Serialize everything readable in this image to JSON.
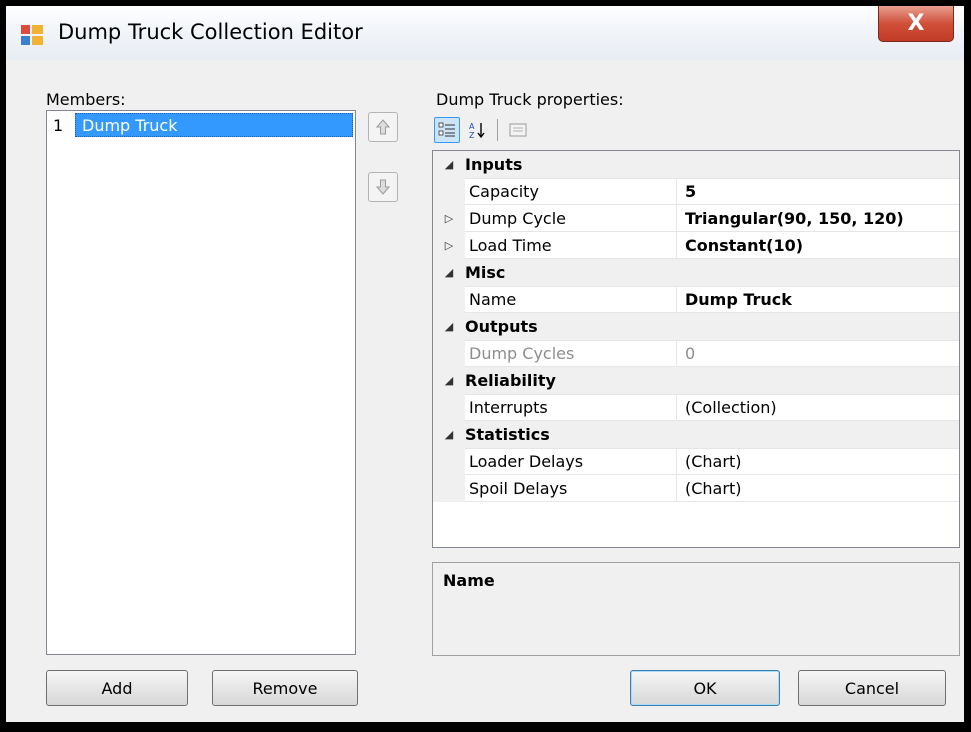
{
  "window": {
    "title": "Dump Truck Collection Editor",
    "close_label": "X"
  },
  "members": {
    "label": "Members:",
    "items": [
      {
        "index": "1",
        "name": "Dump Truck",
        "selected": true
      }
    ]
  },
  "properties": {
    "label": "Dump Truck properties:",
    "toolbar": [
      "categorized-icon",
      "alphabetical-icon",
      "property-pages-icon"
    ],
    "categories": [
      {
        "name": "Inputs",
        "props": [
          {
            "name": "Capacity",
            "value": "5",
            "bold": true,
            "expandable": false
          },
          {
            "name": "Dump Cycle",
            "value": "Triangular(90, 150, 120)",
            "bold": true,
            "expandable": true
          },
          {
            "name": "Load Time",
            "value": "Constant(10)",
            "bold": true,
            "expandable": true
          }
        ]
      },
      {
        "name": "Misc",
        "props": [
          {
            "name": "Name",
            "value": "Dump Truck",
            "bold": true,
            "expandable": false
          }
        ]
      },
      {
        "name": "Outputs",
        "props": [
          {
            "name": "Dump Cycles",
            "value": "0",
            "bold": false,
            "disabled": true,
            "expandable": false
          }
        ]
      },
      {
        "name": "Reliability",
        "props": [
          {
            "name": "Interrupts",
            "value": "(Collection)",
            "bold": false,
            "expandable": false
          }
        ]
      },
      {
        "name": "Statistics",
        "props": [
          {
            "name": "Loader Delays",
            "value": "(Chart)",
            "bold": false,
            "expandable": false
          },
          {
            "name": "Spoil Delays",
            "value": "(Chart)",
            "bold": false,
            "expandable": false
          }
        ]
      }
    ],
    "description_title": "Name"
  },
  "buttons": {
    "add": "Add",
    "remove": "Remove",
    "ok": "OK",
    "cancel": "Cancel"
  }
}
